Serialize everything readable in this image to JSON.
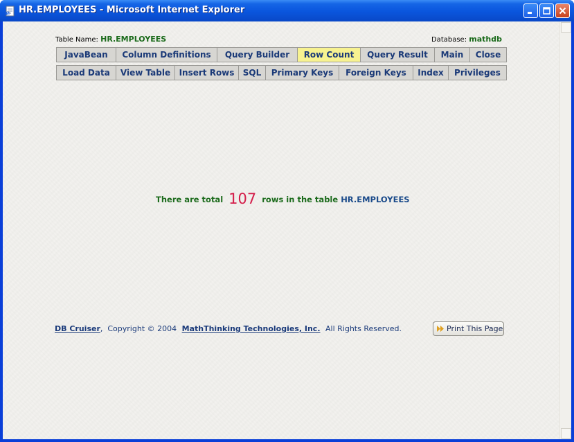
{
  "window": {
    "title": "HR.EMPLOYEES - Microsoft Internet Explorer"
  },
  "meta": {
    "table_label": "Table Name:",
    "table_name": "HR.EMPLOYEES",
    "database_label": "Database:",
    "database_name": "mathdb"
  },
  "nav_row1": [
    {
      "label": "JavaBean",
      "active": false
    },
    {
      "label": "Column Definitions",
      "active": false
    },
    {
      "label": "Query Builder",
      "active": false
    },
    {
      "label": "Row Count",
      "active": true
    },
    {
      "label": "Query Result",
      "active": false
    },
    {
      "label": "Main",
      "active": false
    },
    {
      "label": "Close",
      "active": false
    }
  ],
  "nav_row2": [
    {
      "label": "Load Data",
      "active": false
    },
    {
      "label": "View Table",
      "active": false
    },
    {
      "label": "Insert Rows",
      "active": false
    },
    {
      "label": "SQL",
      "active": false
    },
    {
      "label": "Primary Keys",
      "active": false
    },
    {
      "label": "Foreign Keys",
      "active": false
    },
    {
      "label": "Index",
      "active": false
    },
    {
      "label": "Privileges",
      "active": false
    }
  ],
  "message": {
    "prefix": "There are total",
    "count": "107",
    "middle": "rows in the table",
    "table": "HR.EMPLOYEES"
  },
  "footer": {
    "product_link": "DB Cruiser",
    "copyright": ",  Copyright © 2004",
    "company_link": "MathThinking Technologies, Inc.",
    "rights": "All Rights Reserved.",
    "print_button": "Print This Page"
  },
  "colors": {
    "active_tab": "#f7f290",
    "tab": "#d7d6d2",
    "count": "#d41d4a",
    "green_text": "#1c6b1c"
  }
}
